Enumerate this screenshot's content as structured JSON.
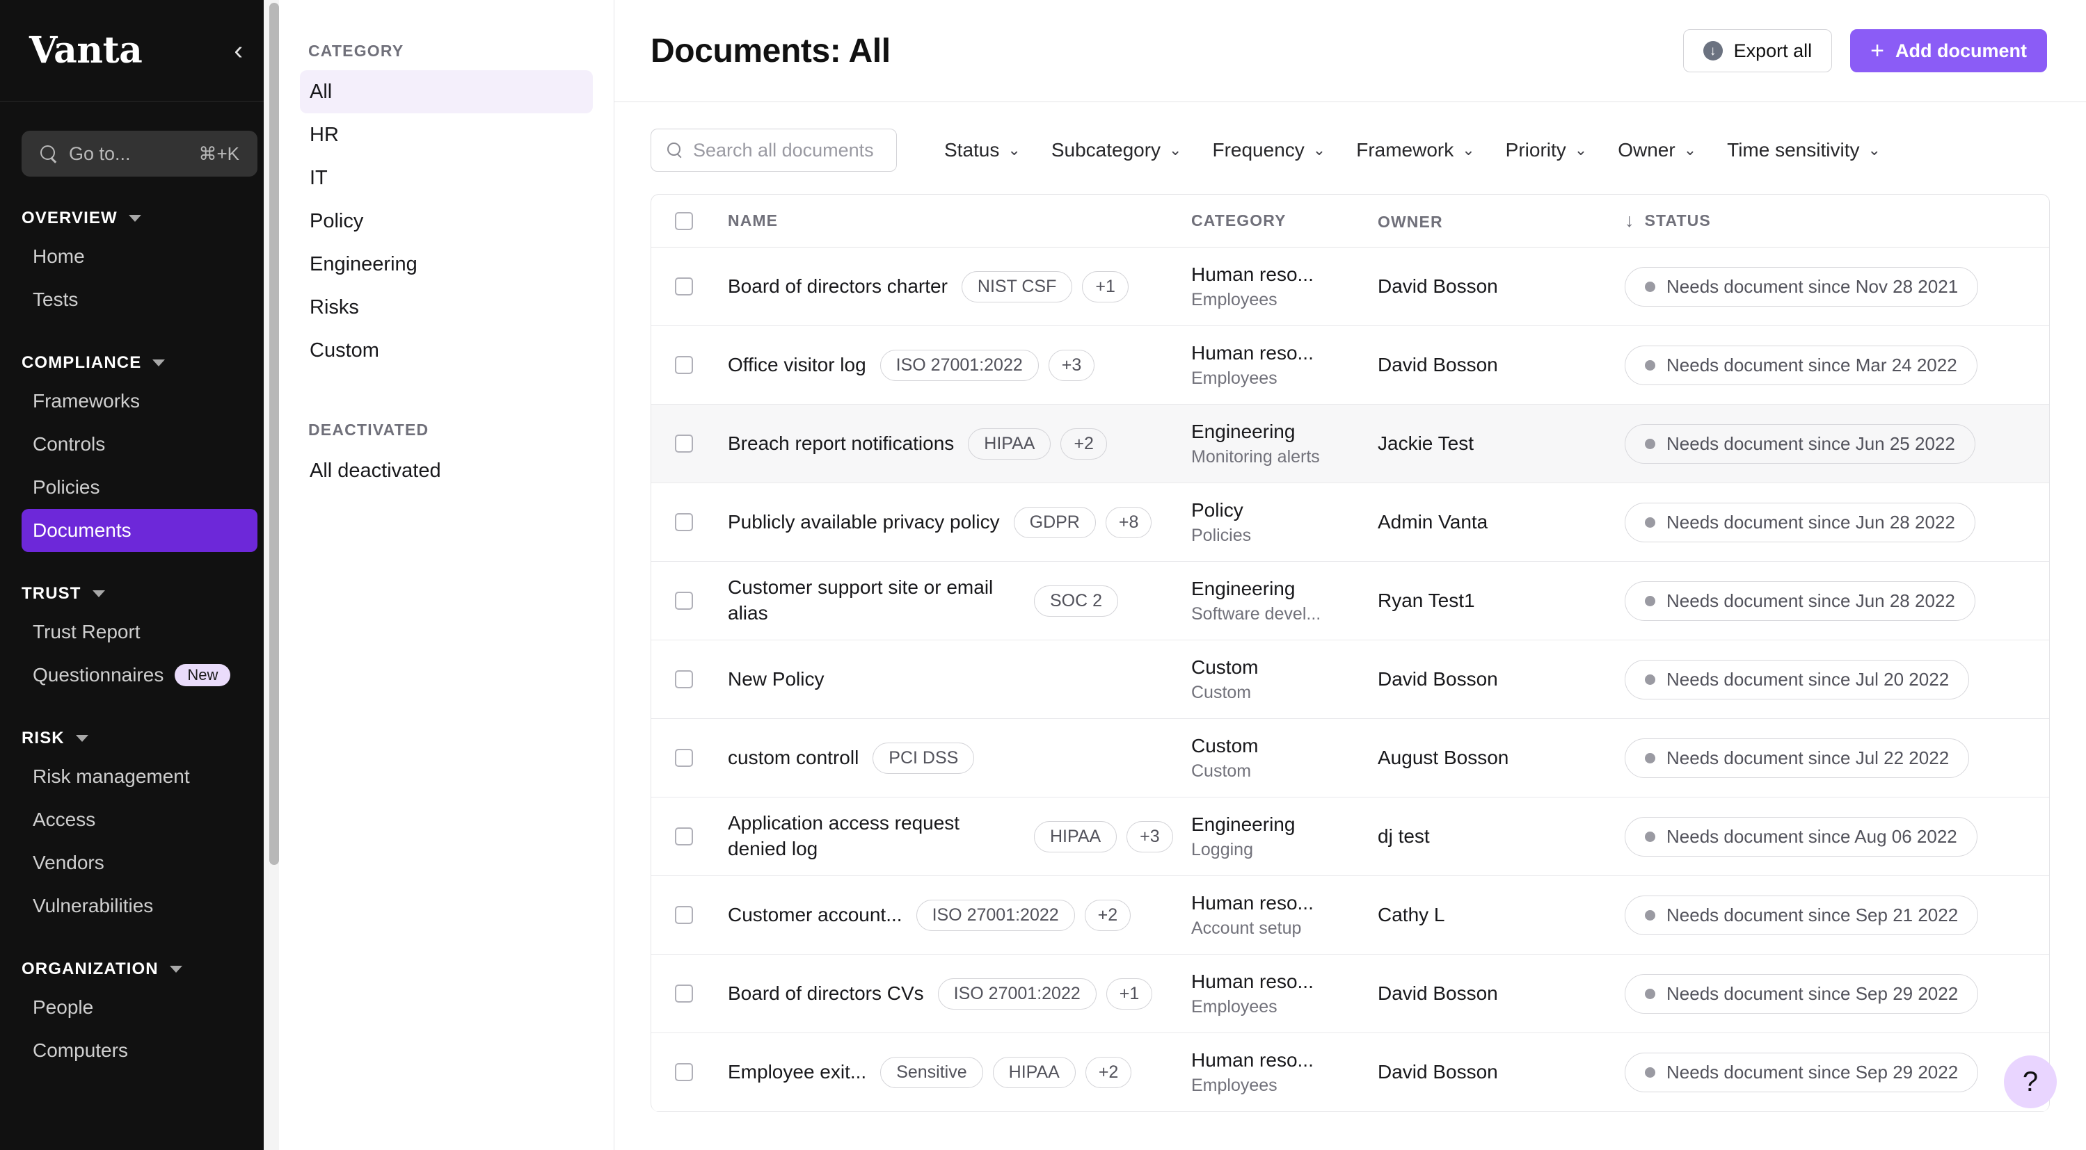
{
  "sidebar": {
    "brand": "Vanta",
    "collapse_icon": "chevron-left-icon",
    "search": {
      "placeholder": "Go to...",
      "shortcut": "⌘+K",
      "icon": "search-icon"
    },
    "sections": [
      {
        "title": "OVERVIEW",
        "items": [
          {
            "label": "Home"
          },
          {
            "label": "Tests"
          }
        ]
      },
      {
        "title": "COMPLIANCE",
        "items": [
          {
            "label": "Frameworks"
          },
          {
            "label": "Controls"
          },
          {
            "label": "Policies"
          },
          {
            "label": "Documents",
            "active": true
          }
        ]
      },
      {
        "title": "TRUST",
        "items": [
          {
            "label": "Trust Report"
          },
          {
            "label": "Questionnaires",
            "badge": "New"
          }
        ]
      },
      {
        "title": "RISK",
        "items": [
          {
            "label": "Risk management"
          },
          {
            "label": "Access"
          },
          {
            "label": "Vendors"
          },
          {
            "label": "Vulnerabilities"
          }
        ]
      },
      {
        "title": "ORGANIZATION",
        "items": [
          {
            "label": "People"
          },
          {
            "label": "Computers"
          }
        ]
      }
    ]
  },
  "category_rail": {
    "category_heading": "CATEGORY",
    "categories": [
      {
        "label": "All",
        "active": true
      },
      {
        "label": "HR"
      },
      {
        "label": "IT"
      },
      {
        "label": "Policy"
      },
      {
        "label": "Engineering"
      },
      {
        "label": "Risks"
      },
      {
        "label": "Custom"
      }
    ],
    "deactivated_heading": "DEACTIVATED",
    "deactivated": [
      {
        "label": "All deactivated"
      }
    ]
  },
  "header": {
    "title": "Documents: All",
    "export_label": "Export all",
    "add_label": "Add document"
  },
  "filters": {
    "search_placeholder": "Search all documents",
    "items": [
      {
        "label": "Status"
      },
      {
        "label": "Subcategory"
      },
      {
        "label": "Frequency"
      },
      {
        "label": "Framework"
      },
      {
        "label": "Priority"
      },
      {
        "label": "Owner"
      },
      {
        "label": "Time sensitivity"
      }
    ]
  },
  "table": {
    "columns": {
      "name": "NAME",
      "category": "CATEGORY",
      "owner": "OWNER",
      "status": "STATUS"
    },
    "sort_indicator": "↓",
    "rows": [
      {
        "name": "Board of directors charter",
        "tags": [
          "NIST CSF",
          "+1"
        ],
        "category": "Human reso...",
        "subcategory": "Employees",
        "owner": "David Bosson",
        "status": "Needs document since Nov 28 2021"
      },
      {
        "name": "Office visitor log",
        "tags": [
          "ISO 27001:2022",
          "+3"
        ],
        "category": "Human reso...",
        "subcategory": "Employees",
        "owner": "David Bosson",
        "status": "Needs document since Mar 24 2022"
      },
      {
        "name": "Breach report notifications",
        "tags": [
          "HIPAA",
          "+2"
        ],
        "category": "Engineering",
        "subcategory": "Monitoring alerts",
        "owner": "Jackie Test",
        "status": "Needs document since Jun 25 2022",
        "highlight": true
      },
      {
        "name": "Publicly available privacy policy",
        "tags": [
          "GDPR",
          "+8"
        ],
        "category": "Policy",
        "subcategory": "Policies",
        "owner": "Admin Vanta",
        "status": "Needs document since Jun 28 2022"
      },
      {
        "name": "Customer support site or email alias",
        "tags": [
          "SOC 2"
        ],
        "category": "Engineering",
        "subcategory": "Software devel...",
        "owner": "Ryan Test1",
        "status": "Needs document since Jun 28 2022"
      },
      {
        "name": "New Policy",
        "tags": [],
        "category": "Custom",
        "subcategory": "Custom",
        "owner": "David Bosson",
        "status": "Needs document since Jul 20 2022"
      },
      {
        "name": "custom controll",
        "tags": [
          "PCI DSS"
        ],
        "category": "Custom",
        "subcategory": "Custom",
        "owner": "August Bosson",
        "status": "Needs document since Jul 22 2022"
      },
      {
        "name": "Application access request denied log",
        "tags": [
          "HIPAA",
          "+3"
        ],
        "category": "Engineering",
        "subcategory": "Logging",
        "owner": "dj test",
        "status": "Needs document since Aug 06 2022"
      },
      {
        "name": "Customer account...",
        "tags": [
          "ISO 27001:2022",
          "+2"
        ],
        "category": "Human reso...",
        "subcategory": "Account setup",
        "owner": "Cathy L",
        "status": "Needs document since Sep 21 2022"
      },
      {
        "name": "Board of directors CVs",
        "tags": [
          "ISO 27001:2022",
          "+1"
        ],
        "category": "Human reso...",
        "subcategory": "Employees",
        "owner": "David Bosson",
        "status": "Needs document since Sep 29 2022"
      },
      {
        "name": "Employee exit...",
        "tags": [
          "Sensitive",
          "HIPAA",
          "+2"
        ],
        "category": "Human reso...",
        "subcategory": "Employees",
        "owner": "David Bosson",
        "status": "Needs document since Sep 29 2022"
      }
    ]
  },
  "help": {
    "icon": "question-mark-icon",
    "label": "?"
  },
  "colors": {
    "accent": "#8B5CF6",
    "nav_active": "#6D28D9",
    "badge_bg": "#EADCFB",
    "help_bg": "#E9D5FF"
  }
}
